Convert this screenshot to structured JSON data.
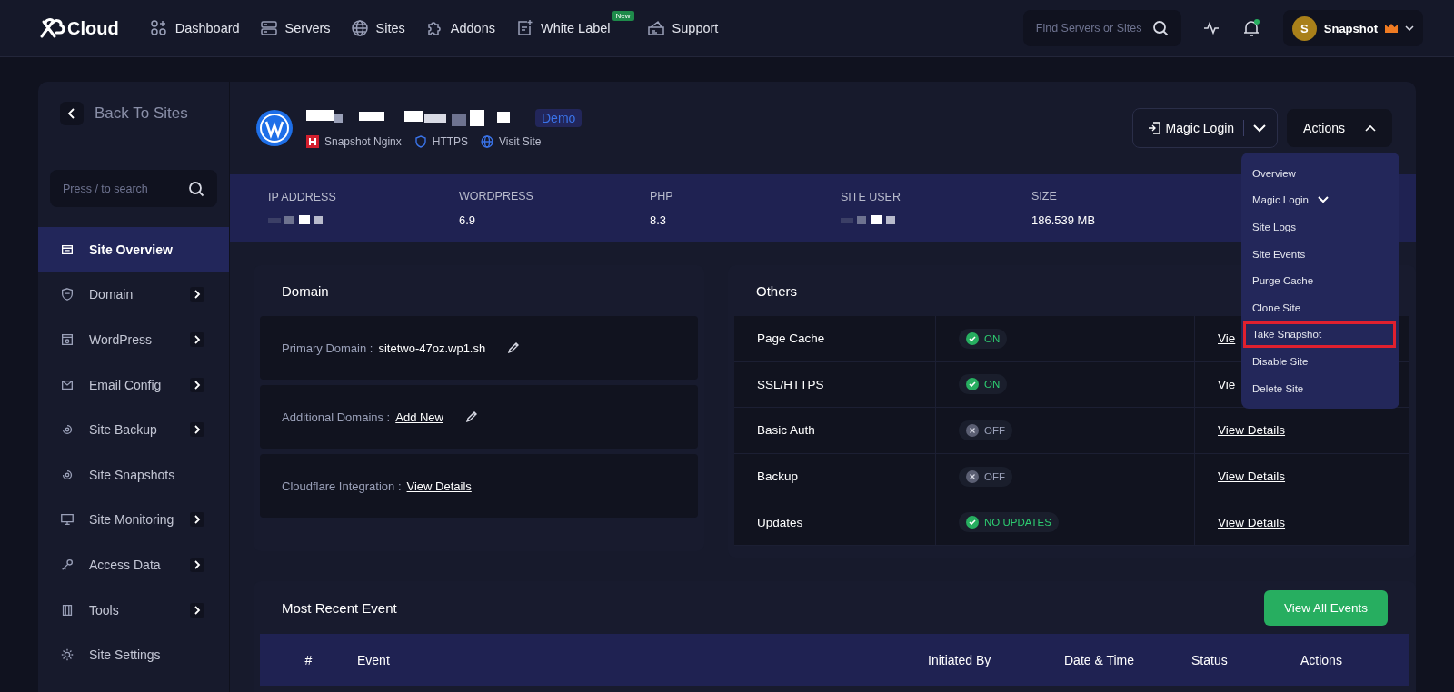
{
  "top_bar": {
    "logo": "Cloud",
    "nav": [
      {
        "label": "Dashboard"
      },
      {
        "label": "Servers"
      },
      {
        "label": "Sites"
      },
      {
        "label": "Addons"
      },
      {
        "label": "White Label",
        "badge": "New"
      },
      {
        "label": "Support"
      }
    ],
    "search": {
      "placeholder": "Find Servers or Sites"
    },
    "notifications": {
      "unread": true
    },
    "user": {
      "initial": "S",
      "name": "Snapshot"
    }
  },
  "sidebar": {
    "back": "Back To Sites",
    "search": {
      "placeholder": "Press / to search"
    },
    "items": [
      {
        "label": "Site Overview",
        "selected": true,
        "expandable": false
      },
      {
        "label": "Domain",
        "selected": false,
        "expandable": true
      },
      {
        "label": "WordPress",
        "selected": false,
        "expandable": true
      },
      {
        "label": "Email Config",
        "selected": false,
        "expandable": true
      },
      {
        "label": "Site Backup",
        "selected": false,
        "expandable": true
      },
      {
        "label": "Site Snapshots",
        "selected": false,
        "expandable": false
      },
      {
        "label": "Site Monitoring",
        "selected": false,
        "expandable": true
      },
      {
        "label": "Access Data",
        "selected": false,
        "expandable": true
      },
      {
        "label": "Tools",
        "selected": false,
        "expandable": true
      },
      {
        "label": "Site Settings",
        "selected": false,
        "expandable": false
      }
    ]
  },
  "site": {
    "name_redacted": true,
    "badge": "Demo",
    "meta": [
      {
        "label": "Snapshot Nginx"
      },
      {
        "label": "HTTPS"
      },
      {
        "label": "Visit Site"
      }
    ],
    "magic_login": "Magic Login",
    "actions": {
      "label": "Actions",
      "expanded": true
    }
  },
  "actions_menu": [
    {
      "label": "Overview",
      "highlighted": false,
      "submenu": false
    },
    {
      "label": "Magic Login",
      "highlighted": false,
      "submenu": true
    },
    {
      "label": "Site Logs",
      "highlighted": false,
      "submenu": false
    },
    {
      "label": "Site Events",
      "highlighted": false,
      "submenu": false
    },
    {
      "label": "Purge Cache",
      "highlighted": false,
      "submenu": false
    },
    {
      "label": "Clone Site",
      "highlighted": false,
      "submenu": false
    },
    {
      "label": "Take Snapshot",
      "highlighted": true,
      "submenu": false
    },
    {
      "label": "Disable Site",
      "highlighted": false,
      "submenu": false
    },
    {
      "label": "Delete Site",
      "highlighted": false,
      "submenu": false
    }
  ],
  "info": [
    {
      "label": "IP ADDRESS",
      "redacted": true
    },
    {
      "label": "WORDPRESS",
      "value": "6.9"
    },
    {
      "label": "PHP",
      "value": "8.3"
    },
    {
      "label": "SITE USER",
      "redacted": true
    },
    {
      "label": "SIZE",
      "value": "186.539 MB"
    }
  ],
  "domain": {
    "title": "Domain",
    "rows": [
      {
        "label": "Primary Domain :",
        "value": "sitetwo-47oz.wp1.sh",
        "kind": "value",
        "editable": true
      },
      {
        "label": "Additional Domains :",
        "value": "Add New",
        "kind": "link",
        "editable": true
      },
      {
        "label": "Cloudflare Integration :",
        "value": "View Details",
        "kind": "link",
        "editable": false
      }
    ]
  },
  "others": {
    "title": "Others",
    "rows": [
      {
        "name": "Page Cache",
        "on": true,
        "status": "ON",
        "link": "Vie"
      },
      {
        "name": "SSL/HTTPS",
        "on": true,
        "status": "ON",
        "link": "Vie"
      },
      {
        "name": "Basic Auth",
        "on": false,
        "status": "OFF",
        "link": "View Details"
      },
      {
        "name": "Backup",
        "on": false,
        "status": "OFF",
        "link": "View Details"
      },
      {
        "name": "Updates",
        "on": true,
        "status": "NO UPDATES",
        "link": "View Details"
      }
    ]
  },
  "events": {
    "title": "Most Recent Event",
    "button": "View All Events",
    "columns": [
      "#",
      "Event",
      "Initiated By",
      "Date & Time",
      "Status",
      "Actions"
    ]
  }
}
